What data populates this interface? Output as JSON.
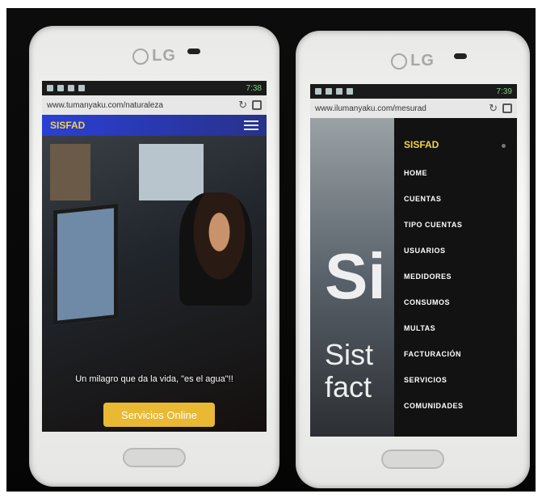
{
  "left_phone": {
    "brand": "LG",
    "time": "7:38",
    "url": "www.tumanyaku.com/naturaleza",
    "site_brand": "SISFAD",
    "tagline": "Un milagro que da la vida, \"es el agua\"!!",
    "cta_label": "Servicios Online"
  },
  "right_phone": {
    "brand": "LG",
    "time": "7:39",
    "url": "www.ilumanyaku.com/mesurad",
    "background_big": "Si",
    "background_word1": "Sist",
    "background_word2": "fact",
    "menu_title": "SISFAD",
    "menu_items": [
      "HOME",
      "CUENTAS",
      "TIPO CUENTAS",
      "USUARIOS",
      "MEDIDORES",
      "CONSUMOS",
      "MULTAS",
      "FACTURACIÓN",
      "SERVICIOS",
      "COMUNIDADES"
    ]
  },
  "colors": {
    "accent_yellow": "#f1d347",
    "nav_blue": "#2a3fd6",
    "cta": "#e9b934"
  }
}
